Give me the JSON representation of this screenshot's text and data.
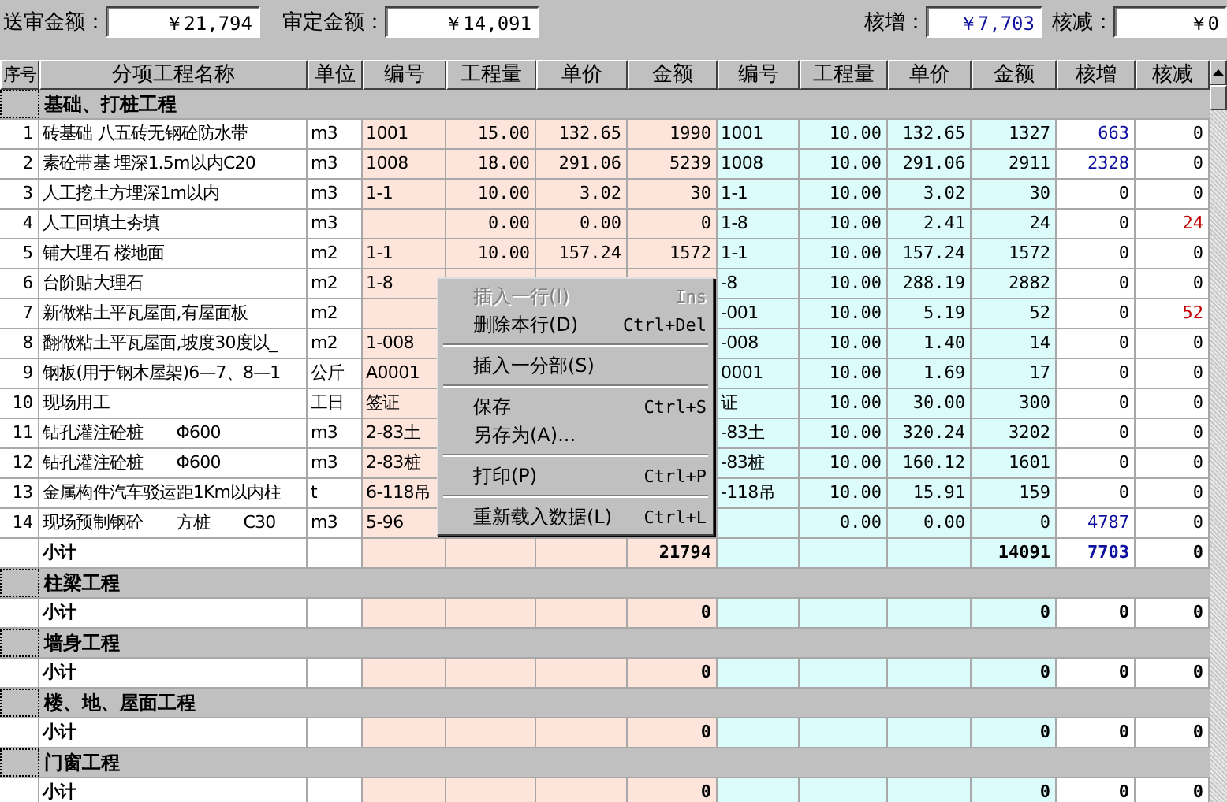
{
  "summary": [
    {
      "label": "送审金额：",
      "value": "￥21,794"
    },
    {
      "label": "审定金额：",
      "value": "￥14,091"
    },
    {
      "label": "核增：",
      "value": "￥7,703",
      "color": "#1010a0"
    },
    {
      "label": "核减：",
      "value": "￥0",
      "color": "#000000"
    }
  ],
  "columns": [
    "序号",
    "分项工程名称",
    "单位",
    "编号",
    "工程量",
    "单价",
    "金额",
    "编号",
    "工程量",
    "单价",
    "金额",
    "核增",
    "核减"
  ],
  "rows": [
    {
      "kind": "section",
      "title": "基础、打桩工程"
    },
    {
      "kind": "item",
      "seq": "1",
      "name": "砖基础 八五砖无钢砼防水带",
      "unit": "m3",
      "code1": "1001",
      "qty1": "15.00",
      "price1": "132.65",
      "amt1": "1990",
      "code2": "1001",
      "qty2": "10.00",
      "price2": "132.65",
      "amt2": "1327",
      "inc": {
        "text": "663",
        "color": "#1010a0"
      },
      "dec": "0"
    },
    {
      "kind": "item",
      "seq": "2",
      "name": "素砼带基 埋深1.5m以内C20",
      "unit": "m3",
      "code1": "1008",
      "qty1": "18.00",
      "price1": "291.06",
      "amt1": "5239",
      "code2": "1008",
      "qty2": "10.00",
      "price2": "291.06",
      "amt2": "2911",
      "inc": {
        "text": "2328",
        "color": "#1010a0"
      },
      "dec": "0"
    },
    {
      "kind": "item",
      "seq": "3",
      "name": "人工挖土方埋深1m以内",
      "unit": "m3",
      "code1": "1-1",
      "qty1": "10.00",
      "price1": "3.02",
      "amt1": "30",
      "code2": "1-1",
      "qty2": "10.00",
      "price2": "3.02",
      "amt2": "30",
      "inc": "0",
      "dec": "0"
    },
    {
      "kind": "item",
      "seq": "4",
      "name": "人工回填土夯填",
      "unit": "m3",
      "qty1": "0.00",
      "price1": "0.00",
      "amt1": "0",
      "code2": "1-8",
      "qty2": "10.00",
      "price2": "2.41",
      "amt2": "24",
      "inc": "0",
      "dec": {
        "text": "24",
        "color": "#c00000"
      }
    },
    {
      "kind": "item",
      "seq": "5",
      "name": "铺大理石 楼地面",
      "unit": "m2",
      "code1": "1-1",
      "qty1": "10.00",
      "price1": "157.24",
      "amt1": "1572",
      "code2": "1-1",
      "qty2": "10.00",
      "price2": "157.24",
      "amt2": "1572",
      "inc": "0",
      "dec": "0"
    },
    {
      "kind": "item",
      "seq": "6",
      "name": "台阶贴大理石",
      "unit": "m2",
      "code1": "1-8",
      "code2": "-8",
      "qty2": "10.00",
      "price2": "288.19",
      "amt2": "2882",
      "inc": "0",
      "dec": "0"
    },
    {
      "kind": "item",
      "seq": "7",
      "name": "新做粘土平瓦屋面,有屋面板",
      "unit": "m2",
      "code2": "-001",
      "qty2": "10.00",
      "price2": "5.19",
      "amt2": "52",
      "inc": "0",
      "dec": {
        "text": "52",
        "color": "#c00000"
      }
    },
    {
      "kind": "item",
      "seq": "8",
      "name": "翻做粘土平瓦屋面,坡度30度以_",
      "unit": "m2",
      "code1": "1-008",
      "code2": "-008",
      "qty2": "10.00",
      "price2": "1.40",
      "amt2": "14",
      "inc": "0",
      "dec": "0"
    },
    {
      "kind": "item",
      "seq": "9",
      "name": "钢板(用于钢木屋架)6—7、8—1",
      "unit": "公斤",
      "code1": "A0001",
      "code2": "0001",
      "qty2": "10.00",
      "price2": "1.69",
      "amt2": "17",
      "inc": "0",
      "dec": "0"
    },
    {
      "kind": "item",
      "seq": "10",
      "name": "现场用工",
      "unit": "工日",
      "code1": "签证",
      "code2": "证",
      "qty2": "10.00",
      "price2": "30.00",
      "amt2": "300",
      "inc": "0",
      "dec": "0"
    },
    {
      "kind": "item",
      "seq": "11",
      "name": "钻孔灌注砼桩　　Φ600",
      "unit": "m3",
      "code1": "2-83土",
      "code2": "-83土",
      "qty2": "10.00",
      "price2": "320.24",
      "amt2": "3202",
      "inc": "0",
      "dec": "0"
    },
    {
      "kind": "item",
      "seq": "12",
      "name": "钻孔灌注砼桩　　Φ600",
      "unit": "m3",
      "code1": "2-83桩",
      "code2": "-83桩",
      "qty2": "10.00",
      "price2": "160.12",
      "amt2": "1601",
      "inc": "0",
      "dec": "0"
    },
    {
      "kind": "item",
      "seq": "13",
      "name": "金属构件汽车驳运距1Km以内柱",
      "unit": "t",
      "code1": "6-118吊",
      "code2": "-118吊",
      "qty2": "10.00",
      "price2": "15.91",
      "amt2": "159",
      "inc": "0",
      "dec": "0"
    },
    {
      "kind": "item",
      "seq": "14",
      "name": "现场预制钢砼　　方桩　　C30",
      "unit": "m3",
      "code1": "5-96",
      "qty2": "0.00",
      "price2": "0.00",
      "amt2": "0",
      "inc": {
        "text": "4787",
        "color": "#1010a0"
      },
      "dec": "0"
    },
    {
      "kind": "subtotal",
      "name": "小计",
      "amt1": "21794",
      "amt2": "14091",
      "inc": {
        "text": "7703",
        "color": "#1010a0"
      },
      "dec": "0"
    },
    {
      "kind": "section",
      "title": "柱梁工程"
    },
    {
      "kind": "subtotal",
      "name": "小计",
      "amt1": "0",
      "amt2": "0",
      "inc": "0",
      "dec": "0"
    },
    {
      "kind": "section",
      "title": "墙身工程"
    },
    {
      "kind": "subtotal",
      "name": "小计",
      "amt1": "0",
      "amt2": "0",
      "inc": "0",
      "dec": "0"
    },
    {
      "kind": "section",
      "title": "楼、地、屋面工程"
    },
    {
      "kind": "subtotal",
      "name": "小计",
      "amt1": "0",
      "amt2": "0",
      "inc": "0",
      "dec": "0"
    },
    {
      "kind": "section",
      "title": "门窗工程"
    },
    {
      "kind": "subtotal",
      "name": "小计",
      "amt1": "0",
      "amt2": "0",
      "inc": "0",
      "dec": "0"
    }
  ],
  "context_menu": [
    {
      "kind": "item",
      "label": "插入一行(I)",
      "shortcut": "Ins",
      "disabled": true
    },
    {
      "kind": "item",
      "label": "删除本行(D)",
      "shortcut": "Ctrl+Del",
      "disabled": false
    },
    {
      "kind": "separator"
    },
    {
      "kind": "item",
      "label": "插入一分部(S)",
      "disabled": false
    },
    {
      "kind": "separator"
    },
    {
      "kind": "item",
      "label": "保存",
      "shortcut": "Ctrl+S",
      "disabled": false
    },
    {
      "kind": "item",
      "label": "另存为(A)...",
      "disabled": false
    },
    {
      "kind": "separator"
    },
    {
      "kind": "item",
      "label": "打印(P)",
      "shortcut": "Ctrl+P",
      "disabled": false
    },
    {
      "kind": "separator"
    },
    {
      "kind": "item",
      "label": "重新载入数据(L)",
      "shortcut": "Ctrl+L",
      "disabled": false
    }
  ]
}
